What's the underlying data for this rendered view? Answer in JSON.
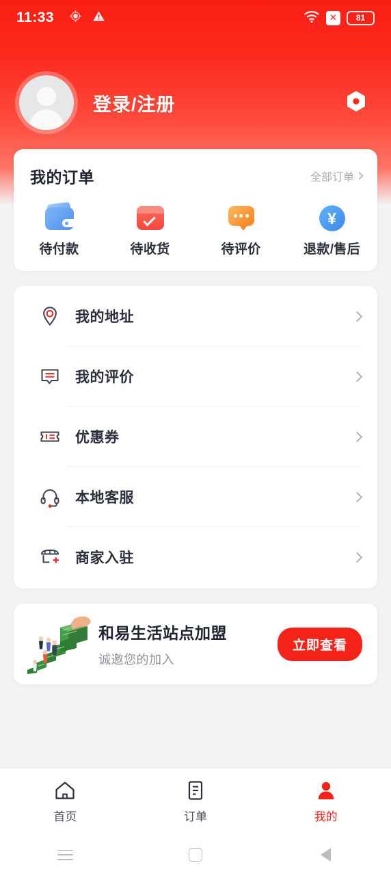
{
  "theme": {
    "brand_red": "#f4231a",
    "hero_red": "#fa1e14",
    "navy": "#2b303c",
    "muted": "#8d929b"
  },
  "status_bar": {
    "time": "11:33",
    "battery_level": "81",
    "icons": [
      "location-icon",
      "warning-icon",
      "wifi-icon",
      "no-sim-icon",
      "battery-icon"
    ]
  },
  "header": {
    "login_label": "登录/注册",
    "avatar_icon": "default-avatar-icon",
    "settings_icon": "settings-gear-icon"
  },
  "orders": {
    "title": "我的订单",
    "all_orders_label": "全部订单",
    "items": [
      {
        "label": "待付款",
        "icon": "wallet-icon"
      },
      {
        "label": "待收货",
        "icon": "box-check-icon"
      },
      {
        "label": "待评价",
        "icon": "chat-bubble-icon"
      },
      {
        "label": "退款/售后",
        "icon": "yuan-refund-icon"
      }
    ]
  },
  "menu": {
    "items": [
      {
        "label": "我的地址",
        "icon": "location-pin-icon"
      },
      {
        "label": "我的评价",
        "icon": "comment-lines-icon"
      },
      {
        "label": "优惠券",
        "icon": "coupon-ticket-icon"
      },
      {
        "label": "本地客服",
        "icon": "headset-icon"
      },
      {
        "label": "商家入驻",
        "icon": "shop-plus-icon"
      }
    ]
  },
  "banner": {
    "title": "和易生活站点加盟",
    "subtitle": "诚邀您的加入",
    "button_label": "立即查看",
    "art_icon": "money-stairs-illustration"
  },
  "tabbar": {
    "tabs": [
      {
        "label": "首页",
        "icon": "home-icon",
        "active": false
      },
      {
        "label": "订单",
        "icon": "order-doc-icon",
        "active": false
      },
      {
        "label": "我的",
        "icon": "person-icon",
        "active": true
      }
    ]
  },
  "android_nav": {
    "recents_icon": "recents-icon",
    "home_icon": "home-square-icon",
    "back_icon": "back-triangle-icon"
  }
}
